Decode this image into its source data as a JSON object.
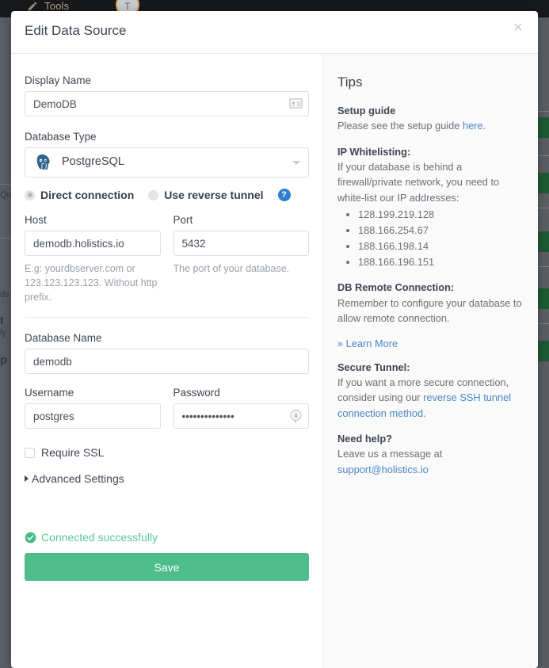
{
  "background": {
    "topbar": {
      "tools_label": "Tools",
      "avatar_initial": "T",
      "pencil_icon": "pencil-icon"
    },
    "left_ghost_lines": [
      "Qu",
      "ds",
      "t",
      "ly",
      "p"
    ]
  },
  "modal": {
    "title": "Edit Data Source",
    "close_icon": "close-icon"
  },
  "form": {
    "display_name": {
      "label": "Display Name",
      "value": "DemoDB",
      "placeholder": "",
      "icon": "contact-card-icon"
    },
    "database_type": {
      "label": "Database Type",
      "value": "PostgreSQL",
      "logo_icon": "postgresql-elephant-icon",
      "caret_icon": "chevron-down-icon",
      "options": [
        "PostgreSQL"
      ]
    },
    "connection_mode": {
      "direct_label": "Direct connection",
      "tunnel_label": "Use reverse tunnel",
      "selected": "direct",
      "help_icon": "question-mark-icon",
      "help_glyph": "?"
    },
    "host": {
      "label": "Host",
      "value": "demodb.holistics.io",
      "placeholder": "",
      "hint": "E.g: yourdbserver.com or 123.123.123.123. Without http prefix."
    },
    "port": {
      "label": "Port",
      "value": "5432",
      "placeholder": "",
      "hint": "The port of your database."
    },
    "database_name": {
      "label": "Database Name",
      "value": "demodb",
      "placeholder": ""
    },
    "username": {
      "label": "Username",
      "value": "postgres",
      "placeholder": ""
    },
    "password": {
      "label": "Password",
      "value": "••••••••••••••",
      "placeholder": "",
      "icon": "lock-refresh-icon"
    },
    "require_ssl": {
      "label": "Require SSL",
      "checked": false
    },
    "advanced_settings": {
      "label": "Advanced Settings",
      "caret_icon": "caret-right-icon",
      "expanded": false
    },
    "status": {
      "text": "Connected successfully",
      "icon": "check-circle-icon",
      "color": "#5fc894"
    },
    "save_label": "Save",
    "save_color": "#4ebd89"
  },
  "tips": {
    "title": "Tips",
    "setup_guide": {
      "heading": "Setup guide",
      "text_before": "Please see the setup guide ",
      "link": "here",
      "text_after": "."
    },
    "ip_whitelisting": {
      "heading": "IP Whitelisting:",
      "text": "If your database is behind a firewall/private network, you need to white-list our IP addresses:",
      "addresses": [
        "128.199.219.128",
        "188.166.254.67",
        "188.166.198.14",
        "188.166.196.151"
      ]
    },
    "db_remote": {
      "heading": "DB Remote Connection:",
      "text": "Remember to configure your database to allow remote connection."
    },
    "learn_more": "» Learn More",
    "secure_tunnel": {
      "heading": "Secure Tunnel:",
      "text_before": "If you want a more secure connection, consider using our ",
      "link": "reverse SSH tunnel connection method",
      "text_after": "."
    },
    "need_help": {
      "heading": "Need help?",
      "text_before": "Leave us a message at ",
      "link": "support@holistics.io"
    }
  }
}
